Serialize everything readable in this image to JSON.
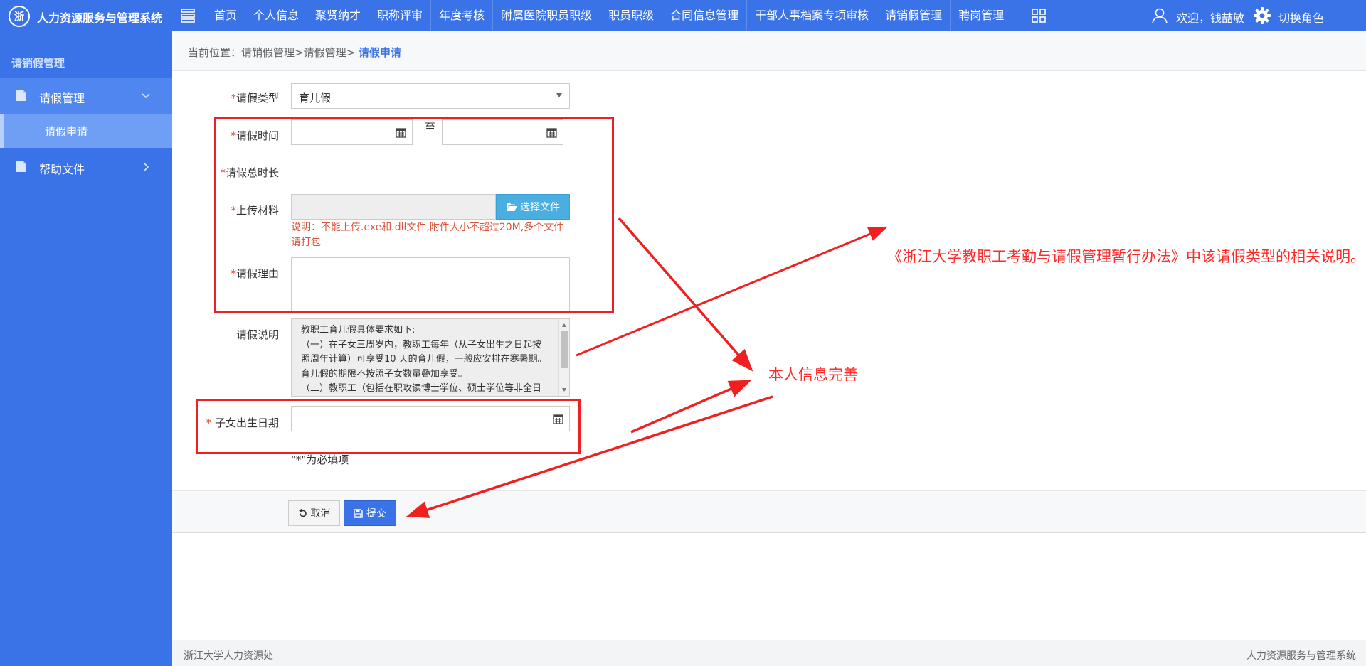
{
  "app": {
    "logo_char": "浙",
    "title": "人力资源服务与管理系统"
  },
  "nav": [
    "首页",
    "个人信息",
    "聚贤纳才",
    "职称评审",
    "年度考核",
    "附属医院职员职级",
    "职员职级",
    "合同信息管理",
    "干部人事档案专项审核",
    "请销假管理",
    "聘岗管理"
  ],
  "user": {
    "welcome": "欢迎，钱喆敏",
    "switch_role": "切换角色"
  },
  "sidebar": {
    "title": "请销假管理",
    "groups": [
      {
        "label": "请假管理",
        "icon": "file-icon",
        "expanded": true,
        "children": [
          "请假申请"
        ]
      },
      {
        "label": "帮助文件",
        "icon": "file-icon",
        "expanded": false
      }
    ]
  },
  "breadcrumb": {
    "prefix": "当前位置：请销假管理>请假管理> ",
    "current": "请假申请"
  },
  "form": {
    "leave_type": {
      "label": "请假类型",
      "value": "育儿假"
    },
    "leave_time": {
      "label": "请假时间",
      "to": "至",
      "start": "",
      "end": ""
    },
    "total_duration": {
      "label": "请假总时长"
    },
    "upload": {
      "label": "上传材料",
      "button": "选择文件",
      "hint": "说明：不能上传.exe和.dll文件,附件大小不超过20M,多个文件请打包"
    },
    "reason": {
      "label": "请假理由",
      "value": ""
    },
    "description": {
      "label": "请假说明",
      "lines": [
        "教职工育儿假具体要求如下:",
        "（一）在子女三周岁内，教职工每年（从子女出生之日起按",
        "照周年计算）可享受10 天的育儿假，一般应安排在寒暑期。育儿假的期限不按照子女数量叠加享受。",
        "（二）教职工（包括在职攻读博士学位、硕士学位等非全日"
      ]
    },
    "child_birth": {
      "label": "子女出生日期",
      "value": ""
    },
    "required_note": "\"*\"为必填项",
    "required_mark": "*",
    "child_required_mark": "* "
  },
  "actions": {
    "cancel": "取消",
    "submit": "提交"
  },
  "footer": {
    "left": "浙江大学人力资源处",
    "right": "人力资源服务与管理系统"
  },
  "annotations": {
    "policy_note": "《浙江大学教职工考勤与请假管理暂行办法》中该请假类型的相关说明。",
    "self_info": "本人信息完善",
    "color": "#f02020"
  },
  "colors": {
    "primary": "#3a73e8",
    "sidebar_active": "#4f86f0",
    "sidebar_sub": "#6f9ef5",
    "file_button": "#4aaee0",
    "hint": "#d9543a"
  }
}
